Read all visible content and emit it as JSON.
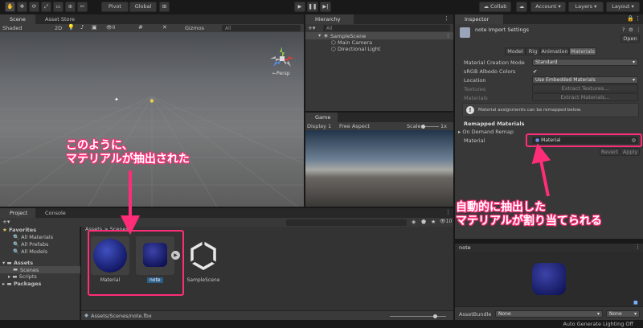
{
  "toolbar": {
    "pivot": "Pivot",
    "global": "Global",
    "collab": "Collab",
    "account": "Account",
    "layers": "Layers",
    "layout": "Layout"
  },
  "scene": {
    "tab_scene": "Scene",
    "tab_asset_store": "Asset Store",
    "shading": "Shaded",
    "mode_2d": "2D",
    "gizmos": "Gizmos",
    "search_placeholder": "All",
    "persp": "←Persp"
  },
  "hierarchy": {
    "tab": "Hierarchy",
    "search_placeholder": "All",
    "scene_name": "SampleScene",
    "items": [
      "Main Camera",
      "Directional Light"
    ]
  },
  "game": {
    "tab": "Game",
    "display": "Display 1",
    "aspect": "Free Aspect",
    "scale_label": "Scale",
    "scale_value": "1x"
  },
  "inspector": {
    "tab": "Inspector",
    "title": "note Import Settings",
    "open": "Open",
    "tabs": [
      "Model",
      "Rig",
      "Animation",
      "Materials"
    ],
    "material_creation_mode_label": "Material Creation Mode",
    "material_creation_mode_value": "Standard",
    "srgb_label": "sRGB Albedo Colors",
    "srgb_check": "✔",
    "location_label": "Location",
    "location_value": "Use Embedded Materials",
    "textures_label": "Textures",
    "extract_textures": "Extract Textures...",
    "materials_label": "Materials",
    "extract_materials": "Extract Materials...",
    "info_text": "Material assignments can be remapped below.",
    "remapped_header": "Remapped Materials",
    "on_demand_remap": "On Demand Remap",
    "material_label": "Material",
    "material_value": "Material",
    "revert": "Revert",
    "apply": "Apply",
    "preview_title": "note",
    "assetbundle_label": "AssetBundle",
    "assetbundle_value": "None",
    "assetbundle_variant": "None"
  },
  "project": {
    "tab_project": "Project",
    "tab_console": "Console",
    "favorites": "Favorites",
    "favorite_items": [
      "All Materials",
      "All Prefabs",
      "All Models"
    ],
    "assets": "Assets",
    "asset_children": [
      "Scenes",
      "Scripts"
    ],
    "packages": "Packages",
    "breadcrumb": "Assets > Scenes",
    "files": [
      "Material",
      "note",
      "SampleScene"
    ],
    "status_path": "Assets/Scenes/note.fbx",
    "search_placeholder": "",
    "badge": "10"
  },
  "statusbar": {
    "text": "Auto Generate Lighting Off"
  },
  "annotations": {
    "left_line1": "このように、",
    "left_line2": "マテリアルが抽出された",
    "right_line1": "自動的に抽出した",
    "right_line2": "マテリアルが割り当てられる"
  },
  "colors": {
    "accent": "#ff2d77",
    "selection": "#2c5d87"
  }
}
